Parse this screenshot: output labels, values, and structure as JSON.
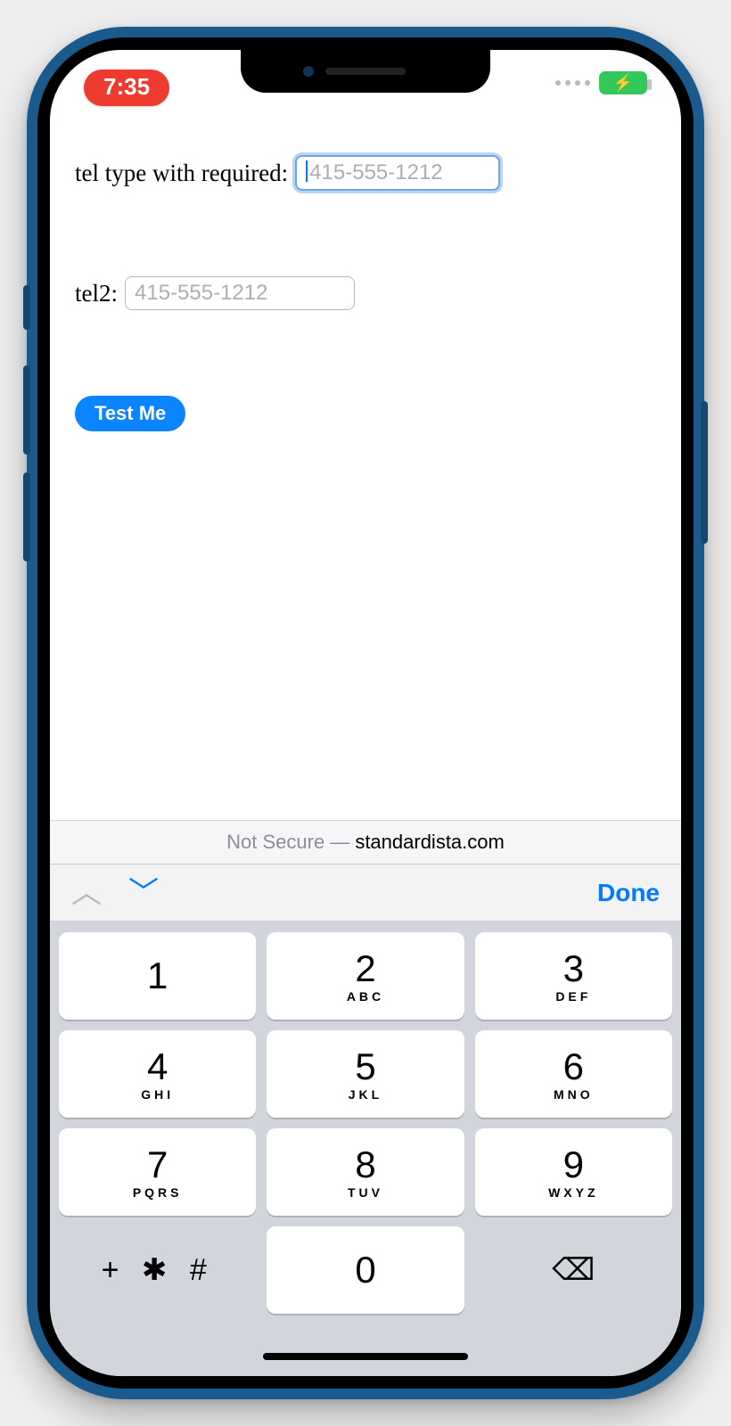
{
  "status": {
    "time": "7:35"
  },
  "form": {
    "label1": "tel type with required:",
    "placeholder1": "415-555-1212",
    "label2": "tel2:",
    "placeholder2": "415-555-1212",
    "button": "Test Me"
  },
  "urlbar": {
    "prefix": "Not Secure —",
    "domain": "standardista.com"
  },
  "kb_toolbar": {
    "done": "Done"
  },
  "keypad": {
    "keys": [
      {
        "d": "1",
        "l": ""
      },
      {
        "d": "2",
        "l": "ABC"
      },
      {
        "d": "3",
        "l": "DEF"
      },
      {
        "d": "4",
        "l": "GHI"
      },
      {
        "d": "5",
        "l": "JKL"
      },
      {
        "d": "6",
        "l": "MNO"
      },
      {
        "d": "7",
        "l": "PQRS"
      },
      {
        "d": "8",
        "l": "TUV"
      },
      {
        "d": "9",
        "l": "WXYZ"
      }
    ],
    "sym": "+ * #",
    "zero": "0"
  }
}
